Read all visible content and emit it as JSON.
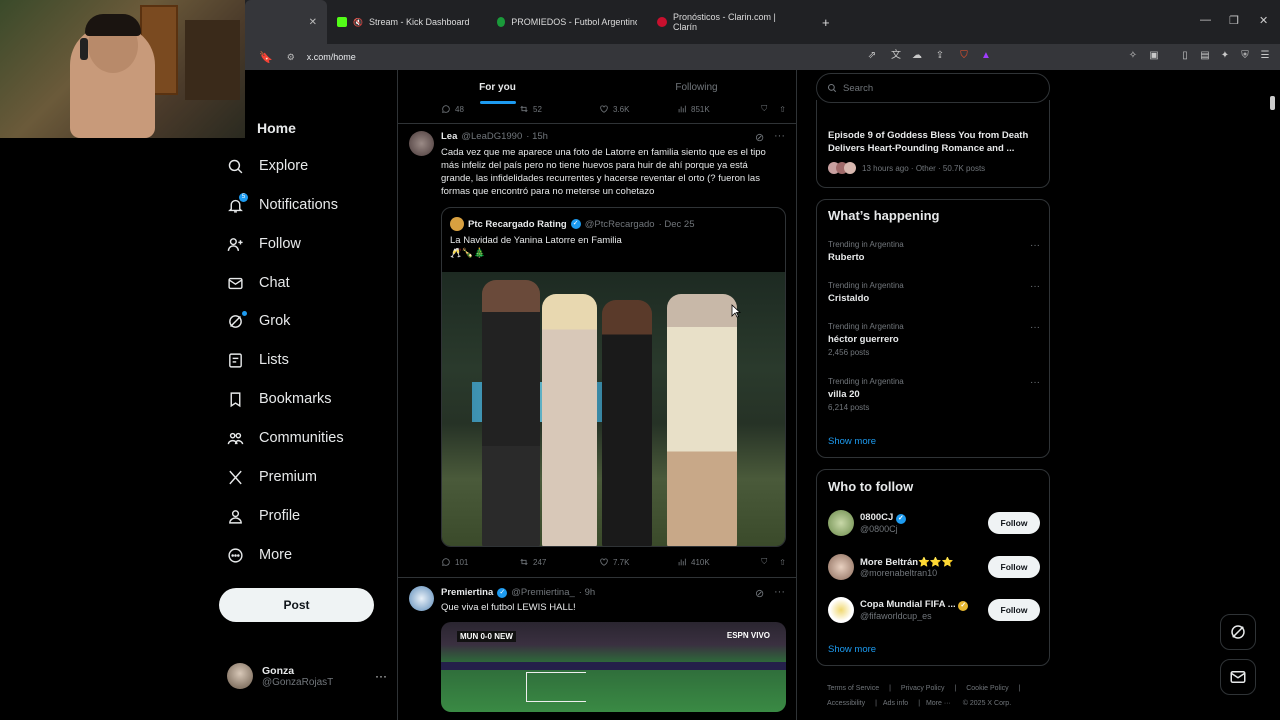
{
  "browser": {
    "tabs": [
      {
        "label": ""
      },
      {
        "label": "Stream - Kick Dashboard"
      },
      {
        "label": "PROMIEDOS - Futbol Argentino - Fi..."
      },
      {
        "label": "Pronósticos - Clarin.com | Clarín"
      }
    ],
    "url": "x.com/home"
  },
  "nav": {
    "home": "Home",
    "explore": "Explore",
    "notifications": "Notifications",
    "notif_count": "5",
    "follow": "Follow",
    "chat": "Chat",
    "grok": "Grok",
    "lists": "Lists",
    "bookmarks": "Bookmarks",
    "communities": "Communities",
    "premium": "Premium",
    "profile": "Profile",
    "more": "More",
    "post": "Post",
    "account_name": "Gonza",
    "account_handle": "@GonzaRojasT"
  },
  "feed": {
    "tabs": [
      "For you",
      "Following"
    ],
    "prev_metrics": {
      "replies": "48",
      "reposts": "52",
      "likes": "3.6K",
      "views": "851K"
    },
    "tweet1": {
      "name": "Lea",
      "handle": "@LeaDG1990",
      "time": "· 15h",
      "text": "Cada vez que me aparece una foto de Latorre en familia siento que es el tipo más infeliz del país pero no tiene huevos para huir de ahí porque ya está grande, las infidelidades recurrentes y hacerse reventar el orto (? fueron las formas que encontró para no meterse un cohetazo",
      "quote": {
        "name": "Ptc Recargado Rating",
        "handle": "@PtcRecargado",
        "time": "· Dec 25",
        "text": "La Navidad de Yanina Latorre en Familia",
        "emojis": "🥂🍾🎄"
      },
      "metrics": {
        "replies": "101",
        "reposts": "247",
        "likes": "7.7K",
        "views": "410K"
      }
    },
    "tweet2": {
      "name": "Premiertina",
      "handle": "@Premiertina_",
      "time": "· 9h",
      "text": "Que viva el futbol LEWIS HALL!",
      "score": "MUN 0-0 NEW",
      "tv": "ESPN VIVO"
    }
  },
  "right": {
    "search_placeholder": "Search",
    "story": {
      "title": "Episode 9 of Goddess Bless You from Death Delivers Heart-Pounding Romance and ...",
      "meta": "13 hours ago · Other · 50.7K posts"
    },
    "happening_title": "What’s happening",
    "trends": [
      {
        "context": "Trending in Argentina",
        "topic": "Ruberto",
        "posts": ""
      },
      {
        "context": "Trending in Argentina",
        "topic": "Cristaldo",
        "posts": ""
      },
      {
        "context": "Trending in Argentina",
        "topic": "héctor guerrero",
        "posts": "2,456 posts"
      },
      {
        "context": "Trending in Argentina",
        "topic": "villa 20",
        "posts": "6,214 posts"
      }
    ],
    "show_more": "Show more",
    "wtf_title": "Who to follow",
    "who_to_follow": [
      {
        "name": "0800CJ",
        "handle": "@0800Cj",
        "button": "Follow"
      },
      {
        "name": "More Beltrán⭐⭐⭐",
        "handle": "@morenabeltran10",
        "button": "Follow"
      },
      {
        "name": "Copa Mundial FIFA ...",
        "handle": "@fifaworldcup_es",
        "button": "Follow"
      }
    ],
    "show_more2": "Show more",
    "footer": [
      "Terms of Service",
      "Privacy Policy",
      "Cookie Policy",
      "Accessibility",
      "Ads info",
      "More ···",
      "© 2025 X Corp."
    ]
  },
  "colors": {
    "accent": "#1d9bf0",
    "background": "#000000",
    "border": "#2f3336",
    "muted": "#71767b"
  }
}
